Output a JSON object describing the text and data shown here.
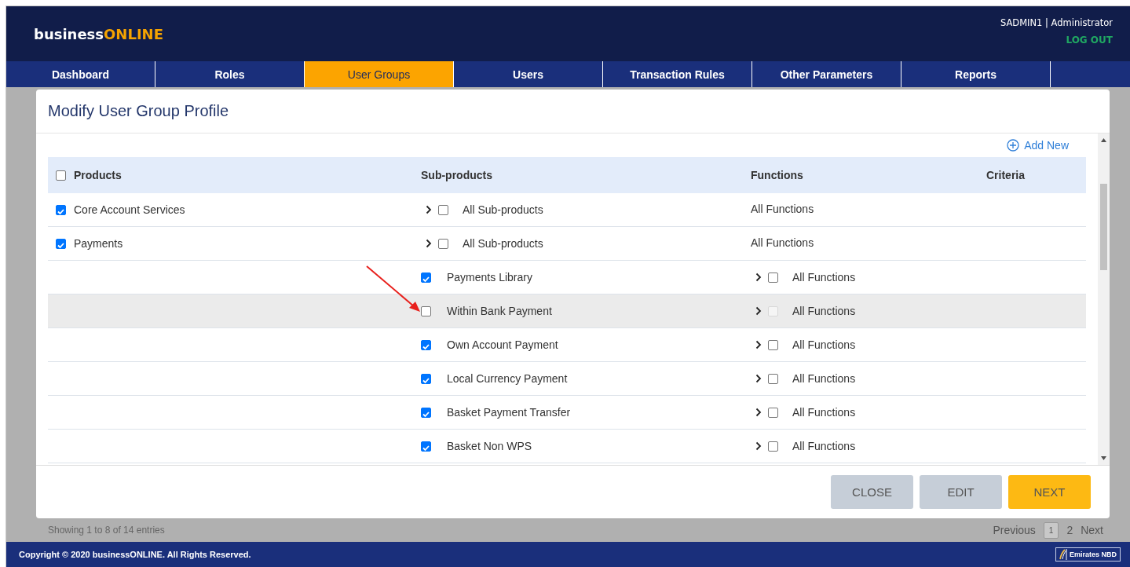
{
  "header": {
    "brand": {
      "text": "business",
      "accent": "ONLINE"
    },
    "user": "SADMIN1 | Administrator",
    "logout": "LOG OUT"
  },
  "nav": [
    {
      "label": "Dashboard",
      "selected": false
    },
    {
      "label": "Roles",
      "selected": false
    },
    {
      "label": "User Groups",
      "selected": true
    },
    {
      "label": "Users",
      "selected": false
    },
    {
      "label": "Transaction Rules",
      "selected": false
    },
    {
      "label": "Other Parameters",
      "selected": false
    },
    {
      "label": "Reports",
      "selected": false
    }
  ],
  "modal": {
    "title": "Modify User Group Profile",
    "add_new": "Add New",
    "table": {
      "select_all_checked": false,
      "columns": [
        "Products",
        "Sub-products",
        "Functions",
        "Criteria"
      ],
      "rows": [
        {
          "kind": "product",
          "name": "Core Account Services",
          "checked": true,
          "sub": "All Sub-products",
          "sub_checked": false,
          "functions": "All Functions",
          "selected": false
        },
        {
          "kind": "product",
          "name": "Payments",
          "checked": true,
          "sub": "All Sub-products",
          "sub_checked": false,
          "functions": "All Functions",
          "selected": false
        },
        {
          "kind": "subproduct",
          "name": "Payments Library",
          "checked": true,
          "functions": "All Functions",
          "functions_checked": false,
          "disabled": false,
          "selected": false
        },
        {
          "kind": "subproduct",
          "name": "Within Bank Payment",
          "checked": false,
          "functions": "All Functions",
          "functions_checked": false,
          "disabled": true,
          "selected": true
        },
        {
          "kind": "subproduct",
          "name": "Own Account Payment",
          "checked": true,
          "functions": "All Functions",
          "functions_checked": false,
          "disabled": false,
          "selected": false
        },
        {
          "kind": "subproduct",
          "name": "Local Currency Payment",
          "checked": true,
          "functions": "All Functions",
          "functions_checked": false,
          "disabled": false,
          "selected": false
        },
        {
          "kind": "subproduct",
          "name": "Basket Payment Transfer",
          "checked": true,
          "functions": "All Functions",
          "functions_checked": false,
          "disabled": false,
          "selected": false
        },
        {
          "kind": "subproduct",
          "name": "Basket Non WPS",
          "checked": true,
          "functions": "All Functions",
          "functions_checked": false,
          "disabled": false,
          "selected": false
        }
      ]
    },
    "buttons": [
      {
        "label": "CLOSE",
        "kind": "secondary"
      },
      {
        "label": "EDIT",
        "kind": "secondary"
      },
      {
        "label": "NEXT",
        "kind": "primary"
      }
    ]
  },
  "entries": "Showing 1 to 8 of 14 entries",
  "pagination": {
    "previous": "Previous",
    "pages": [
      {
        "label": "1",
        "selected": true
      },
      {
        "label": "2",
        "selected": false
      }
    ],
    "next": "Next"
  },
  "footer": {
    "copyright": "Copyright © 2020 businessONLINE. All Rights Reserved.",
    "logo": "Emirates NBD"
  }
}
